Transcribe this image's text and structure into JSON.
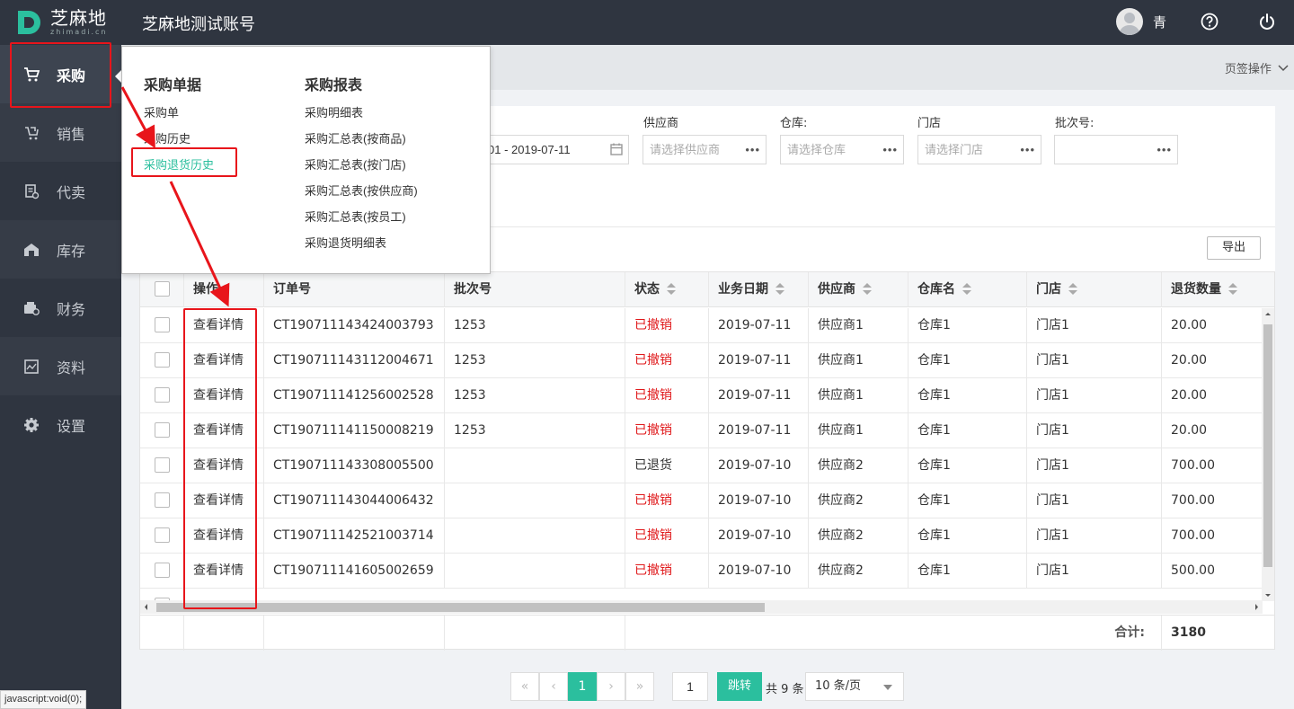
{
  "header": {
    "logo_cn": "芝麻地",
    "logo_en": "zhimadi.cn",
    "title": "芝麻地测试账号",
    "user_name": "青",
    "help_icon": "question-circle-icon",
    "power_icon": "power-icon"
  },
  "sidebar": {
    "items": [
      {
        "label": "采购",
        "icon": "cart-icon"
      },
      {
        "label": "销售",
        "icon": "sales-icon"
      },
      {
        "label": "代卖",
        "icon": "consign-icon"
      },
      {
        "label": "库存",
        "icon": "warehouse-icon"
      },
      {
        "label": "财务",
        "icon": "finance-icon"
      },
      {
        "label": "资料",
        "icon": "data-icon"
      },
      {
        "label": "设置",
        "icon": "gear-icon"
      }
    ]
  },
  "flyout": {
    "col1_title": "采购单据",
    "col1_items": [
      "采购单",
      "采购历史",
      "采购退货历史"
    ],
    "col2_title": "采购报表",
    "col2_items": [
      "采购明细表",
      "采购汇总表(按商品)",
      "采购汇总表(按门店)",
      "采购汇总表(按供应商)",
      "采购汇总表(按员工)",
      "采购退货明细表"
    ]
  },
  "tabbar": {
    "ops_label": "页签操作"
  },
  "filters": {
    "date_value": "01 - 2019-07-11",
    "supplier_label": "供应商",
    "supplier_placeholder": "请选择供应商",
    "warehouse_label": "仓库:",
    "warehouse_placeholder": "请选择仓库",
    "store_label": "门店",
    "store_placeholder": "请选择门店",
    "batch_label": "批次号:",
    "batch_placeholder": "",
    "dots": "•••"
  },
  "export_label": "导出",
  "table": {
    "columns": [
      "操作",
      "订单号",
      "批次号",
      "状态",
      "业务日期",
      "供应商",
      "仓库名",
      "门店",
      "退货数量"
    ],
    "rows": [
      {
        "action": "查看详情",
        "order": "CT190711143424003793",
        "batch": "1253",
        "status": "已撤销",
        "status_red": true,
        "date": "2019-07-11",
        "supplier": "供应商1",
        "warehouse": "仓库1",
        "store": "门店1",
        "qty": "20.00"
      },
      {
        "action": "查看详情",
        "order": "CT190711143112004671",
        "batch": "1253",
        "status": "已撤销",
        "status_red": true,
        "date": "2019-07-11",
        "supplier": "供应商1",
        "warehouse": "仓库1",
        "store": "门店1",
        "qty": "20.00"
      },
      {
        "action": "查看详情",
        "order": "CT190711141256002528",
        "batch": "1253",
        "status": "已撤销",
        "status_red": true,
        "date": "2019-07-11",
        "supplier": "供应商1",
        "warehouse": "仓库1",
        "store": "门店1",
        "qty": "20.00"
      },
      {
        "action": "查看详情",
        "order": "CT190711141150008219",
        "batch": "1253",
        "status": "已撤销",
        "status_red": true,
        "date": "2019-07-11",
        "supplier": "供应商1",
        "warehouse": "仓库1",
        "store": "门店1",
        "qty": "20.00"
      },
      {
        "action": "查看详情",
        "order": "CT190711143308005500",
        "batch": "",
        "status": "已退货",
        "status_red": false,
        "date": "2019-07-10",
        "supplier": "供应商2",
        "warehouse": "仓库1",
        "store": "门店1",
        "qty": "700.00"
      },
      {
        "action": "查看详情",
        "order": "CT190711143044006432",
        "batch": "",
        "status": "已撤销",
        "status_red": true,
        "date": "2019-07-10",
        "supplier": "供应商2",
        "warehouse": "仓库1",
        "store": "门店1",
        "qty": "700.00"
      },
      {
        "action": "查看详情",
        "order": "CT190711142521003714",
        "batch": "",
        "status": "已撤销",
        "status_red": true,
        "date": "2019-07-10",
        "supplier": "供应商2",
        "warehouse": "仓库1",
        "store": "门店1",
        "qty": "700.00"
      },
      {
        "action": "查看详情",
        "order": "CT190711141605002659",
        "batch": "",
        "status": "已撤销",
        "status_red": true,
        "date": "2019-07-10",
        "supplier": "供应商2",
        "warehouse": "仓库1",
        "store": "门店1",
        "qty": "500.00"
      }
    ],
    "total_label": "合计:",
    "total_value": "3180"
  },
  "pagination": {
    "current_page": "1",
    "page_input": "1",
    "jump_label": "跳转",
    "total_text": "共 9 条",
    "page_size": "10 条/页"
  },
  "status_tip": "javascript:void(0);",
  "colors": {
    "accent": "#2bbf9e",
    "sidebar": "#2f3540",
    "annotation": "#e8151b",
    "cancel_red": "#e0191b"
  }
}
